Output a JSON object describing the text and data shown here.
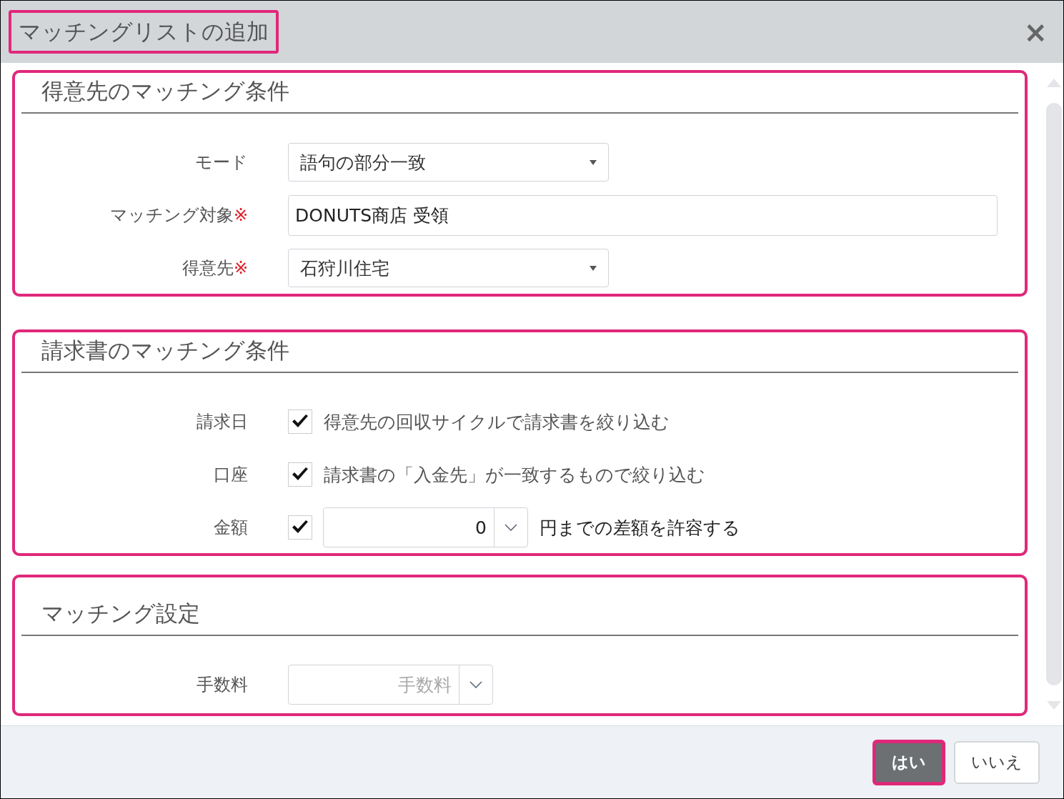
{
  "dialog": {
    "title": "マッチングリストの追加",
    "title_highlighted": true,
    "close": "×"
  },
  "sections": [
    {
      "title": "得意先のマッチング条件",
      "highlighted": true,
      "fields": [
        {
          "kind": "select",
          "label": "モード",
          "value": "語句の部分一致"
        },
        {
          "kind": "text",
          "label": "マッチング対象",
          "required_mark": "※",
          "value": "DONUTS商店 受領"
        },
        {
          "kind": "select",
          "label": "得意先",
          "required_mark": "※",
          "value": "石狩川住宅"
        }
      ]
    },
    {
      "title": "請求書のマッチング条件",
      "highlighted": true,
      "fields": [
        {
          "kind": "checkbox",
          "label": "請求日",
          "checked": true,
          "text": "得意先の回収サイクルで請求書を絞り込む"
        },
        {
          "kind": "checkbox",
          "label": "口座",
          "checked": true,
          "text": "請求書の「入金先」が一致するもので絞り込む"
        },
        {
          "kind": "checkbox_amount",
          "label": "金額",
          "checked": true,
          "value": "0",
          "suffix": "円までの差額を許容する"
        }
      ]
    },
    {
      "title": "マッチング設定",
      "highlighted": true,
      "fields": [
        {
          "kind": "combo",
          "label": "手数料",
          "placeholder": "手数料"
        }
      ]
    }
  ],
  "buttons": [
    {
      "label": "はい",
      "primary": true,
      "highlighted": true
    },
    {
      "label": "いいえ",
      "primary": false,
      "highlighted": false
    }
  ]
}
